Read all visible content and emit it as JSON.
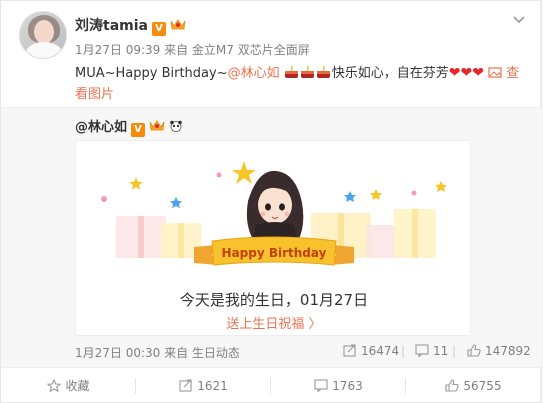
{
  "post": {
    "username": "刘涛tamia",
    "meta": "1月27日 09:39 来自 金立M7 双芯片全面屏",
    "text_prefix": "MUA~Happy Birthday~",
    "mention": "@林心如",
    "text_suffix": "快乐如心，自在芬芳",
    "view_image": "查看图片"
  },
  "repost": {
    "mention": "@林心如",
    "banner": "Happy Birthday",
    "birthday_text": "今天是我的生日，01月27日",
    "wish_link": "送上生日祝福 〉",
    "time": "1月27日 00:30 来自 生日动态",
    "reposts": "16474",
    "comments": "11",
    "likes": "147892"
  },
  "actions": {
    "favorite": "收藏",
    "repost": "1621",
    "comment": "1763",
    "like": "56755"
  },
  "colors": {
    "link": "#eb7350",
    "badge": "#f78b0c",
    "heart": "#e8242c"
  }
}
